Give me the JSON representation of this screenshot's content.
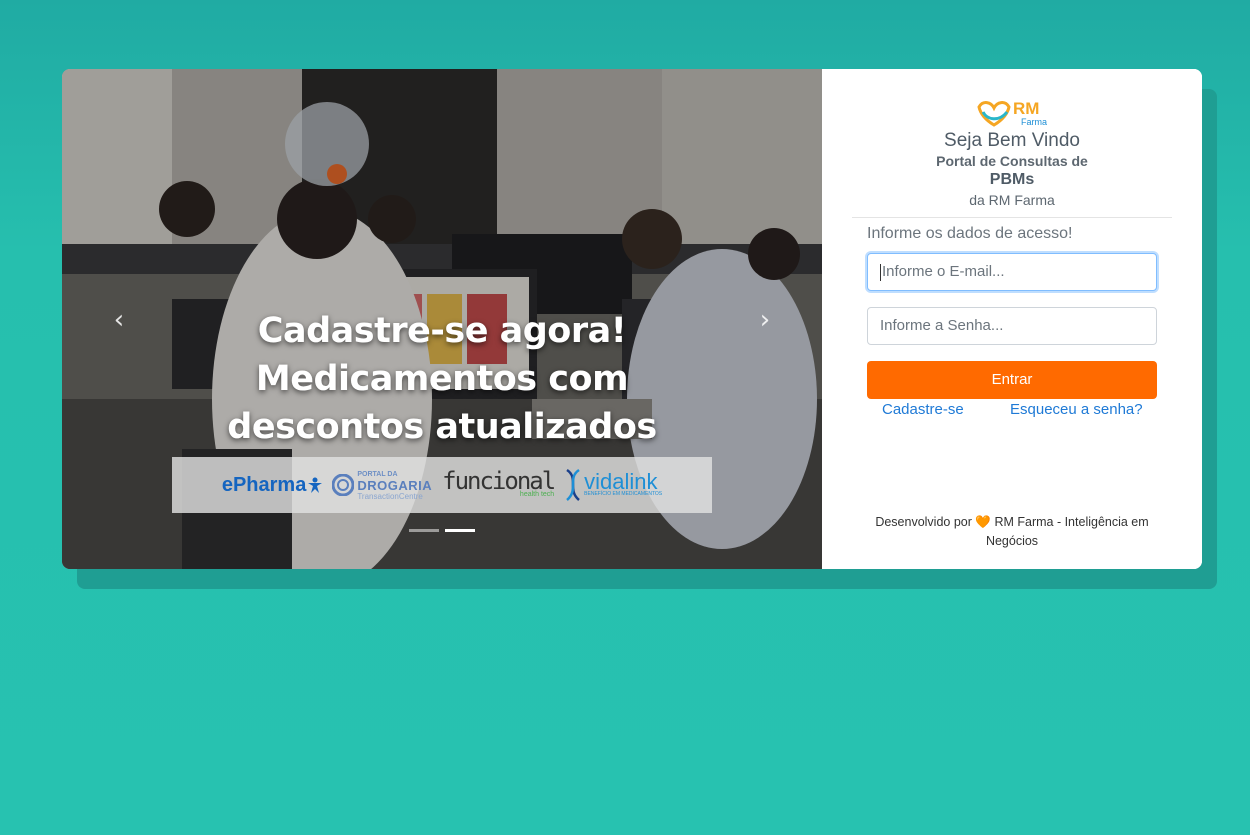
{
  "carousel": {
    "caption_lines": [
      "Cadastre-se agora!",
      "Medicamentos com",
      "descontos atualizados"
    ],
    "partners": {
      "epharma": "ePharma",
      "drogaria_line1": "PORTAL DA",
      "drogaria_line2": "DROGARIA",
      "drogaria_line3": "TransactionCentre",
      "funcional": "funcional",
      "funcional_sub": "health tech",
      "vidalink": "vidalink",
      "vidalink_sub": "BENEFÍCIO EM MEDICAMENTOS"
    },
    "prev_label": "‹",
    "next_label": "›",
    "slide_count": 2,
    "active_slide": 2
  },
  "brand": {
    "logo_text": "RM",
    "logo_sub": "Farma"
  },
  "welcome": {
    "title": "Seja Bem Vindo",
    "line2": "Portal de Consultas de",
    "line3": "PBMs",
    "line4": "da RM Farma"
  },
  "form": {
    "prompt": "Informe os dados de acesso!",
    "email_placeholder": "Informe o E-mail...",
    "password_placeholder": "Informe a Senha...",
    "submit_label": "Entrar",
    "signup_link": "Cadastre-se",
    "forgot_link": "Esqueceu a senha?"
  },
  "footer": {
    "prefix": "Desenvolvido por",
    "heart": "🧡",
    "suffix_line1": "RM Farma - Inteligência em",
    "suffix_line2": "Negócios"
  },
  "colors": {
    "background": "#26bfae",
    "primary_button": "#ff6a00",
    "link": "#1f7ad6"
  }
}
